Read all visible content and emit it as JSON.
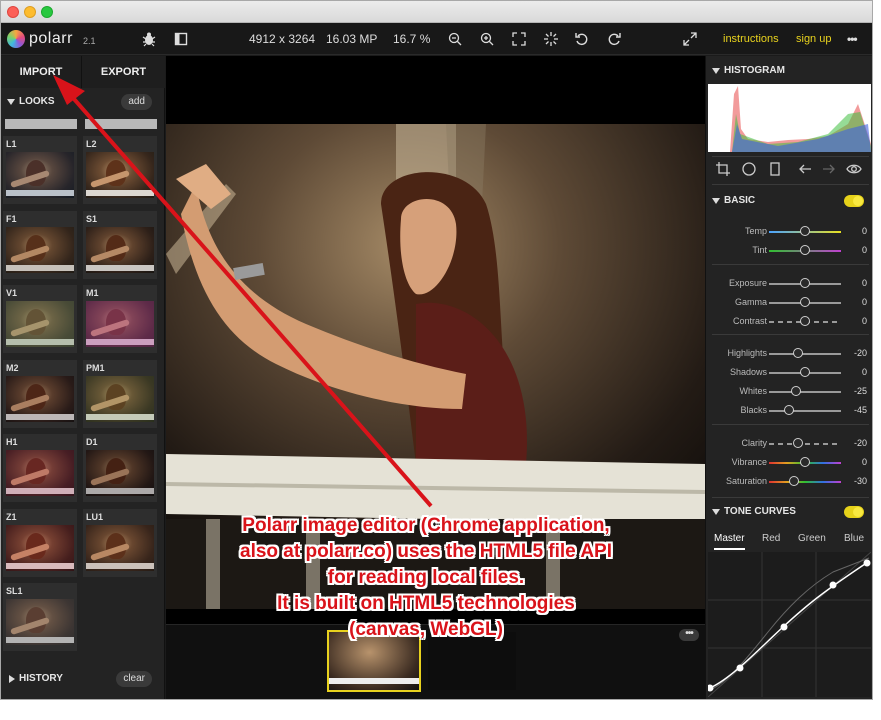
{
  "app": {
    "brand": "polarr",
    "version": "2.1"
  },
  "toolbar": {
    "dimensions": "4912 x 3264",
    "megapixels": "16.03 MP",
    "zoom": "16.7 %",
    "instructions_label": "instructions",
    "signup_label": "sign up",
    "more_label": "•••"
  },
  "left": {
    "import_label": "IMPORT",
    "export_label": "EXPORT",
    "looks_title": "LOOKS",
    "add_label": "add",
    "looks": [
      {
        "label": "L1",
        "tint": "rgba(30,60,90,0.25)"
      },
      {
        "label": "L2",
        "tint": "rgba(120,90,40,0.15)"
      },
      {
        "label": "F1",
        "tint": "rgba(80,60,30,0.25)"
      },
      {
        "label": "S1",
        "tint": "rgba(60,40,20,0.2)"
      },
      {
        "label": "V1",
        "tint": "rgba(110,130,90,0.45)"
      },
      {
        "label": "M1",
        "tint": "rgba(160,60,130,0.45)"
      },
      {
        "label": "M2",
        "tint": "rgba(40,20,20,0.25)"
      },
      {
        "label": "PM1",
        "tint": "rgba(100,120,60,0.3)"
      },
      {
        "label": "H1",
        "tint": "rgba(140,30,60,0.3)"
      },
      {
        "label": "D1",
        "tint": "rgba(20,10,10,0.3)"
      },
      {
        "label": "Z1",
        "tint": "rgba(150,30,40,0.25)"
      },
      {
        "label": "LU1",
        "tint": "rgba(100,60,30,0.25)"
      },
      {
        "label": "SL1",
        "tint": "rgba(90,90,90,0.4)"
      }
    ],
    "history_title": "HISTORY",
    "clear_label": "clear"
  },
  "right": {
    "histogram_title": "HISTOGRAM",
    "basic_title": "BASIC",
    "sliders": [
      {
        "name": "Temp",
        "value": "0",
        "pos": 0.5,
        "track": "#4aa3ff,#e8e020"
      },
      {
        "name": "Tint",
        "value": "0",
        "pos": 0.5,
        "track": "#30c030,#c040d0"
      },
      {
        "name": "Exposure",
        "value": "0",
        "pos": 0.5,
        "track": ""
      },
      {
        "name": "Gamma",
        "value": "0",
        "pos": 0.5,
        "track": ""
      },
      {
        "name": "Contrast",
        "value": "0",
        "pos": 0.5,
        "track": "dashed"
      },
      {
        "name": "Highlights",
        "value": "-20",
        "pos": 0.4,
        "track": ""
      },
      {
        "name": "Shadows",
        "value": "0",
        "pos": 0.5,
        "track": ""
      },
      {
        "name": "Whites",
        "value": "-25",
        "pos": 0.375,
        "track": ""
      },
      {
        "name": "Blacks",
        "value": "-45",
        "pos": 0.275,
        "track": ""
      },
      {
        "name": "Clarity",
        "value": "-20",
        "pos": 0.4,
        "track": "dashed"
      },
      {
        "name": "Vibrance",
        "value": "0",
        "pos": 0.5,
        "track": "#e03030,#e0a020,#30c030,#3070e0,#c040d0"
      },
      {
        "name": "Saturation",
        "value": "-30",
        "pos": 0.35,
        "track": "#e03030,#e0a020,#30c030,#3070e0,#c040d0"
      }
    ],
    "tone_title": "TONE CURVES",
    "tone_tabs": [
      "Master",
      "Red",
      "Green",
      "Blue"
    ]
  },
  "annotation": {
    "lines": [
      "Polarr image editor (Chrome application,",
      "also at polarr.co) uses the HTML5 file API",
      "for reading local files.",
      "It is built on HTML5 technologies",
      "(canvas, WebGL)"
    ]
  },
  "colors": {
    "accent": "#e8d21e",
    "annotation": "#d9131a"
  }
}
